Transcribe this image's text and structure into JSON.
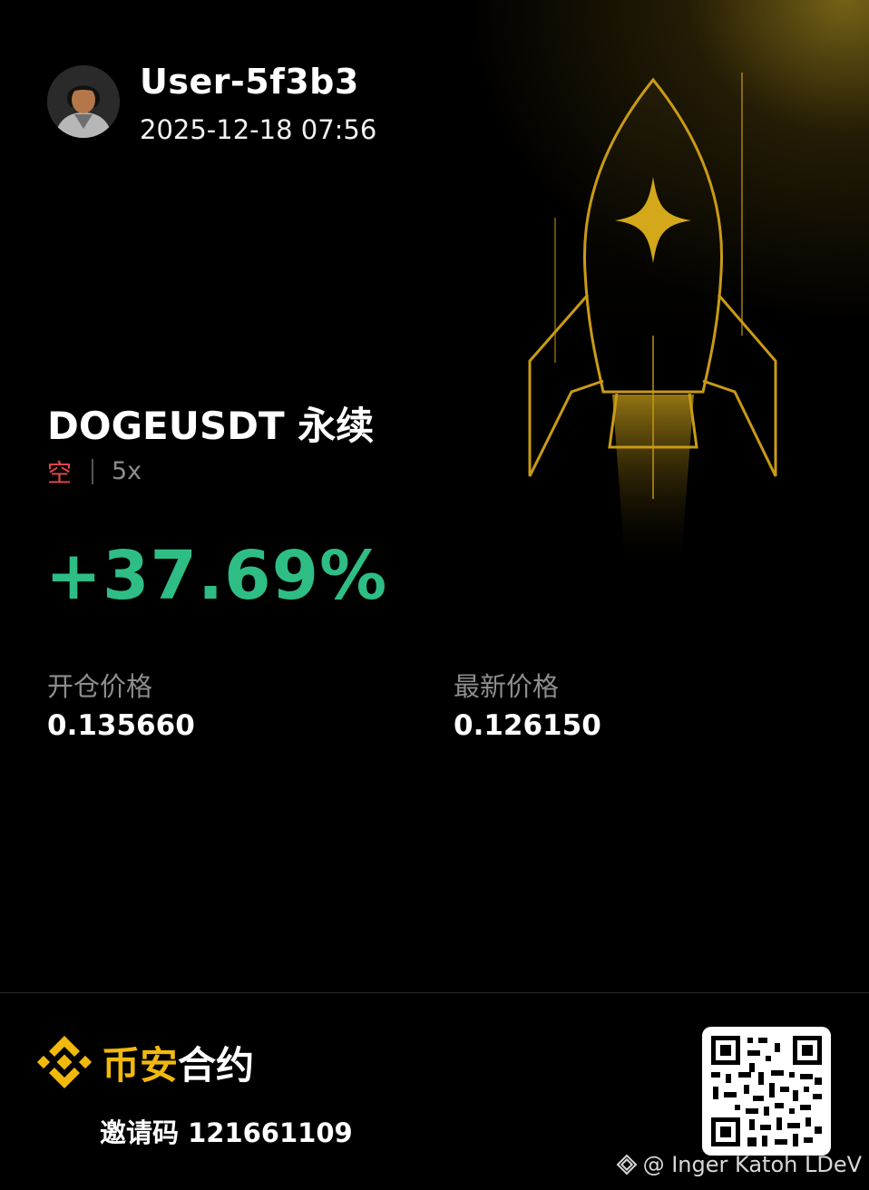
{
  "user": {
    "name": "User-5f3b3",
    "datetime": "2025-12-18 07:56"
  },
  "position": {
    "pair": "DOGEUSDT 永续",
    "side": "空",
    "leverage": "5x",
    "pnl_percent": "+37.69%"
  },
  "prices": {
    "entry_label": "开仓价格",
    "entry_value": "0.135660",
    "latest_label": "最新价格",
    "latest_value": "0.126150"
  },
  "footer": {
    "brand_part1": "币安",
    "brand_part2": "合约",
    "invite": "邀请码 121661109",
    "watermark": "@ Inger Katoh LDeV"
  },
  "colors": {
    "background": "#000000",
    "accent_gold": "#f0b90b",
    "profit_green": "#2ebd85",
    "short_red": "#e5484d",
    "muted_gray": "#8d8d8d"
  },
  "icons": [
    "avatar",
    "rocket-illustration",
    "binance-logo-icon",
    "qr-code",
    "binance-square-icon"
  ]
}
